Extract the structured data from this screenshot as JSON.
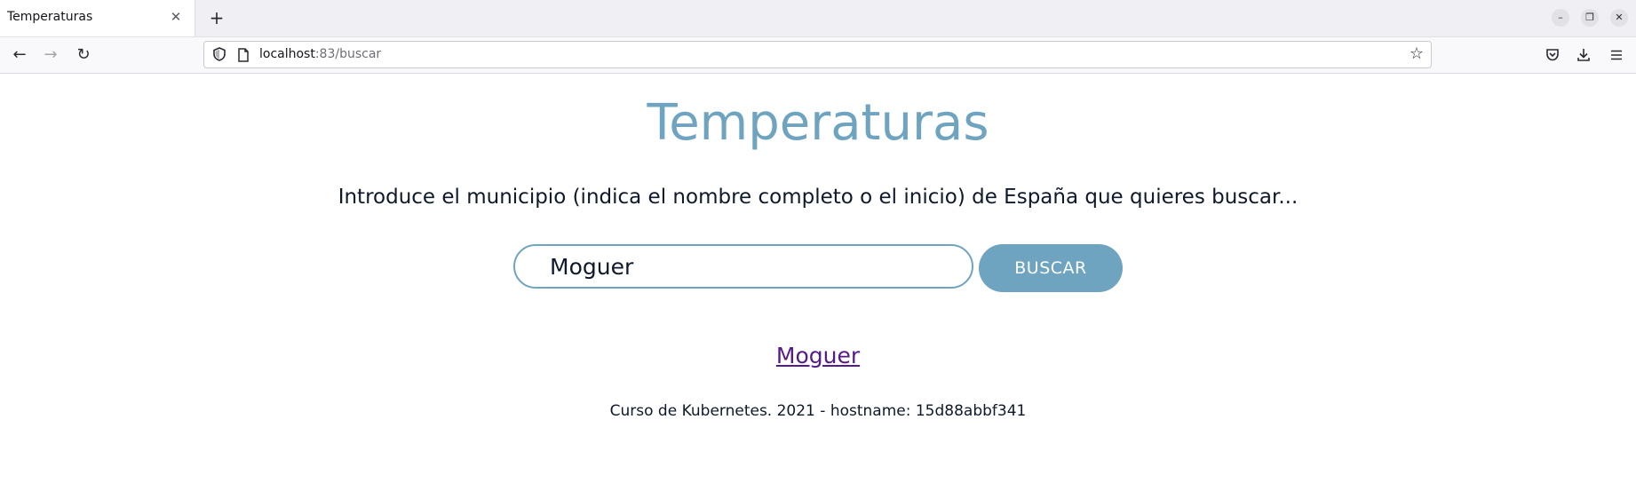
{
  "browser": {
    "tab": {
      "title": "Temperaturas",
      "close_glyph": "✕"
    },
    "newtab_glyph": "+",
    "window": {
      "minimize_glyph": "–",
      "restore_glyph": "❐",
      "close_glyph": "✕"
    },
    "nav": {
      "back_glyph": "←",
      "forward_glyph": "→",
      "reload_glyph": "↻"
    },
    "url": {
      "host": "localhost",
      "rest": ":83/buscar"
    },
    "bookmark_glyph": "☆",
    "toolbar": {
      "pocket_glyph": "◙",
      "download_glyph": "⤓",
      "menu_glyph": "≡"
    },
    "icons": [
      "shield-icon",
      "page-icon",
      "star-icon",
      "pocket-icon",
      "download-icon",
      "menu-icon"
    ]
  },
  "page": {
    "title": "Temperaturas",
    "intro": "Introduce el municipio (indica el nombre completo o el inicio) de España que quieres buscar...",
    "search": {
      "value": "Moguer",
      "button_label": "BUSCAR"
    },
    "results": [
      {
        "label": "Moguer"
      }
    ],
    "footer": "Curso de Kubernetes. 2021 - hostname: 15d88abbf341"
  },
  "colors": {
    "accent": "#6ea4bf",
    "link_visited": "#551a8b",
    "text": "#0e1a2b"
  }
}
